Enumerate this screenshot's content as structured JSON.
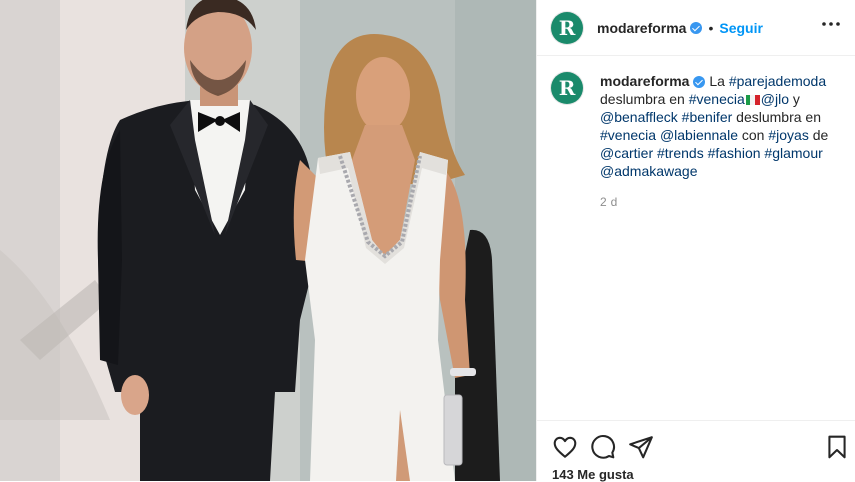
{
  "post": {
    "username": "modareforma",
    "follow_label": "Seguir",
    "separator": "•",
    "more_label": "•••",
    "avatar_letter": "R",
    "caption": {
      "username": "modareforma",
      "p1": "La ",
      "h1": "#parejademoda",
      "p2": " deslumbra en ",
      "h2": "#venecia",
      "p3": "",
      "h3": "@jlo",
      "p4": " y ",
      "h4": "@benaffleck",
      "p5": " ",
      "h5": "#benifer",
      "p6": " deslumbra en ",
      "h6": "#venecia",
      "p7": " ",
      "h7": "@labiennale",
      "p8": " con ",
      "h8": "#joyas",
      "p9": " de ",
      "h9": "@cartier",
      "p10": " ",
      "h10": "#trends",
      "p11": " ",
      "h11": "#fashion",
      "p12": " ",
      "h12": "#glamour",
      "p13": " ",
      "h13": "@admakawage",
      "flag": "italy-flag-emoji"
    },
    "time": "2 d",
    "likes": "143 Me gusta",
    "icons": [
      "heart-icon",
      "comment-icon",
      "share-icon",
      "bookmark-icon"
    ],
    "colors": {
      "brand_avatar": "#1a8a6b",
      "link": "#00376b",
      "follow": "#0095f6",
      "verified": "#3897f0"
    }
  }
}
